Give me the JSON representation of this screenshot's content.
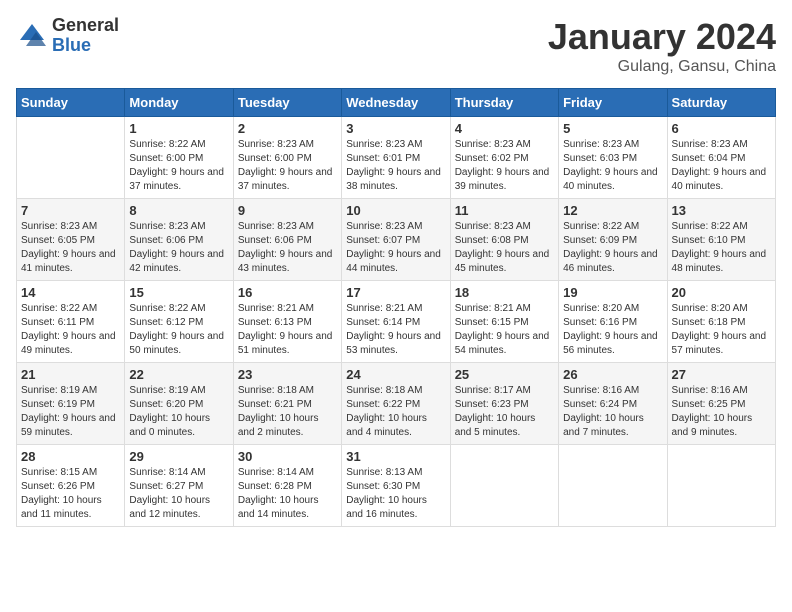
{
  "logo": {
    "general": "General",
    "blue": "Blue"
  },
  "title": "January 2024",
  "subtitle": "Gulang, Gansu, China",
  "header": {
    "days": [
      "Sunday",
      "Monday",
      "Tuesday",
      "Wednesday",
      "Thursday",
      "Friday",
      "Saturday"
    ]
  },
  "weeks": [
    [
      {
        "day": "",
        "sunrise": "",
        "sunset": "",
        "daylight": ""
      },
      {
        "day": "1",
        "sunrise": "Sunrise: 8:22 AM",
        "sunset": "Sunset: 6:00 PM",
        "daylight": "Daylight: 9 hours and 37 minutes."
      },
      {
        "day": "2",
        "sunrise": "Sunrise: 8:23 AM",
        "sunset": "Sunset: 6:00 PM",
        "daylight": "Daylight: 9 hours and 37 minutes."
      },
      {
        "day": "3",
        "sunrise": "Sunrise: 8:23 AM",
        "sunset": "Sunset: 6:01 PM",
        "daylight": "Daylight: 9 hours and 38 minutes."
      },
      {
        "day": "4",
        "sunrise": "Sunrise: 8:23 AM",
        "sunset": "Sunset: 6:02 PM",
        "daylight": "Daylight: 9 hours and 39 minutes."
      },
      {
        "day": "5",
        "sunrise": "Sunrise: 8:23 AM",
        "sunset": "Sunset: 6:03 PM",
        "daylight": "Daylight: 9 hours and 40 minutes."
      },
      {
        "day": "6",
        "sunrise": "Sunrise: 8:23 AM",
        "sunset": "Sunset: 6:04 PM",
        "daylight": "Daylight: 9 hours and 40 minutes."
      }
    ],
    [
      {
        "day": "7",
        "sunrise": "Sunrise: 8:23 AM",
        "sunset": "Sunset: 6:05 PM",
        "daylight": "Daylight: 9 hours and 41 minutes."
      },
      {
        "day": "8",
        "sunrise": "Sunrise: 8:23 AM",
        "sunset": "Sunset: 6:06 PM",
        "daylight": "Daylight: 9 hours and 42 minutes."
      },
      {
        "day": "9",
        "sunrise": "Sunrise: 8:23 AM",
        "sunset": "Sunset: 6:06 PM",
        "daylight": "Daylight: 9 hours and 43 minutes."
      },
      {
        "day": "10",
        "sunrise": "Sunrise: 8:23 AM",
        "sunset": "Sunset: 6:07 PM",
        "daylight": "Daylight: 9 hours and 44 minutes."
      },
      {
        "day": "11",
        "sunrise": "Sunrise: 8:23 AM",
        "sunset": "Sunset: 6:08 PM",
        "daylight": "Daylight: 9 hours and 45 minutes."
      },
      {
        "day": "12",
        "sunrise": "Sunrise: 8:22 AM",
        "sunset": "Sunset: 6:09 PM",
        "daylight": "Daylight: 9 hours and 46 minutes."
      },
      {
        "day": "13",
        "sunrise": "Sunrise: 8:22 AM",
        "sunset": "Sunset: 6:10 PM",
        "daylight": "Daylight: 9 hours and 48 minutes."
      }
    ],
    [
      {
        "day": "14",
        "sunrise": "Sunrise: 8:22 AM",
        "sunset": "Sunset: 6:11 PM",
        "daylight": "Daylight: 9 hours and 49 minutes."
      },
      {
        "day": "15",
        "sunrise": "Sunrise: 8:22 AM",
        "sunset": "Sunset: 6:12 PM",
        "daylight": "Daylight: 9 hours and 50 minutes."
      },
      {
        "day": "16",
        "sunrise": "Sunrise: 8:21 AM",
        "sunset": "Sunset: 6:13 PM",
        "daylight": "Daylight: 9 hours and 51 minutes."
      },
      {
        "day": "17",
        "sunrise": "Sunrise: 8:21 AM",
        "sunset": "Sunset: 6:14 PM",
        "daylight": "Daylight: 9 hours and 53 minutes."
      },
      {
        "day": "18",
        "sunrise": "Sunrise: 8:21 AM",
        "sunset": "Sunset: 6:15 PM",
        "daylight": "Daylight: 9 hours and 54 minutes."
      },
      {
        "day": "19",
        "sunrise": "Sunrise: 8:20 AM",
        "sunset": "Sunset: 6:16 PM",
        "daylight": "Daylight: 9 hours and 56 minutes."
      },
      {
        "day": "20",
        "sunrise": "Sunrise: 8:20 AM",
        "sunset": "Sunset: 6:18 PM",
        "daylight": "Daylight: 9 hours and 57 minutes."
      }
    ],
    [
      {
        "day": "21",
        "sunrise": "Sunrise: 8:19 AM",
        "sunset": "Sunset: 6:19 PM",
        "daylight": "Daylight: 9 hours and 59 minutes."
      },
      {
        "day": "22",
        "sunrise": "Sunrise: 8:19 AM",
        "sunset": "Sunset: 6:20 PM",
        "daylight": "Daylight: 10 hours and 0 minutes."
      },
      {
        "day": "23",
        "sunrise": "Sunrise: 8:18 AM",
        "sunset": "Sunset: 6:21 PM",
        "daylight": "Daylight: 10 hours and 2 minutes."
      },
      {
        "day": "24",
        "sunrise": "Sunrise: 8:18 AM",
        "sunset": "Sunset: 6:22 PM",
        "daylight": "Daylight: 10 hours and 4 minutes."
      },
      {
        "day": "25",
        "sunrise": "Sunrise: 8:17 AM",
        "sunset": "Sunset: 6:23 PM",
        "daylight": "Daylight: 10 hours and 5 minutes."
      },
      {
        "day": "26",
        "sunrise": "Sunrise: 8:16 AM",
        "sunset": "Sunset: 6:24 PM",
        "daylight": "Daylight: 10 hours and 7 minutes."
      },
      {
        "day": "27",
        "sunrise": "Sunrise: 8:16 AM",
        "sunset": "Sunset: 6:25 PM",
        "daylight": "Daylight: 10 hours and 9 minutes."
      }
    ],
    [
      {
        "day": "28",
        "sunrise": "Sunrise: 8:15 AM",
        "sunset": "Sunset: 6:26 PM",
        "daylight": "Daylight: 10 hours and 11 minutes."
      },
      {
        "day": "29",
        "sunrise": "Sunrise: 8:14 AM",
        "sunset": "Sunset: 6:27 PM",
        "daylight": "Daylight: 10 hours and 12 minutes."
      },
      {
        "day": "30",
        "sunrise": "Sunrise: 8:14 AM",
        "sunset": "Sunset: 6:28 PM",
        "daylight": "Daylight: 10 hours and 14 minutes."
      },
      {
        "day": "31",
        "sunrise": "Sunrise: 8:13 AM",
        "sunset": "Sunset: 6:30 PM",
        "daylight": "Daylight: 10 hours and 16 minutes."
      },
      {
        "day": "",
        "sunrise": "",
        "sunset": "",
        "daylight": ""
      },
      {
        "day": "",
        "sunrise": "",
        "sunset": "",
        "daylight": ""
      },
      {
        "day": "",
        "sunrise": "",
        "sunset": "",
        "daylight": ""
      }
    ]
  ]
}
